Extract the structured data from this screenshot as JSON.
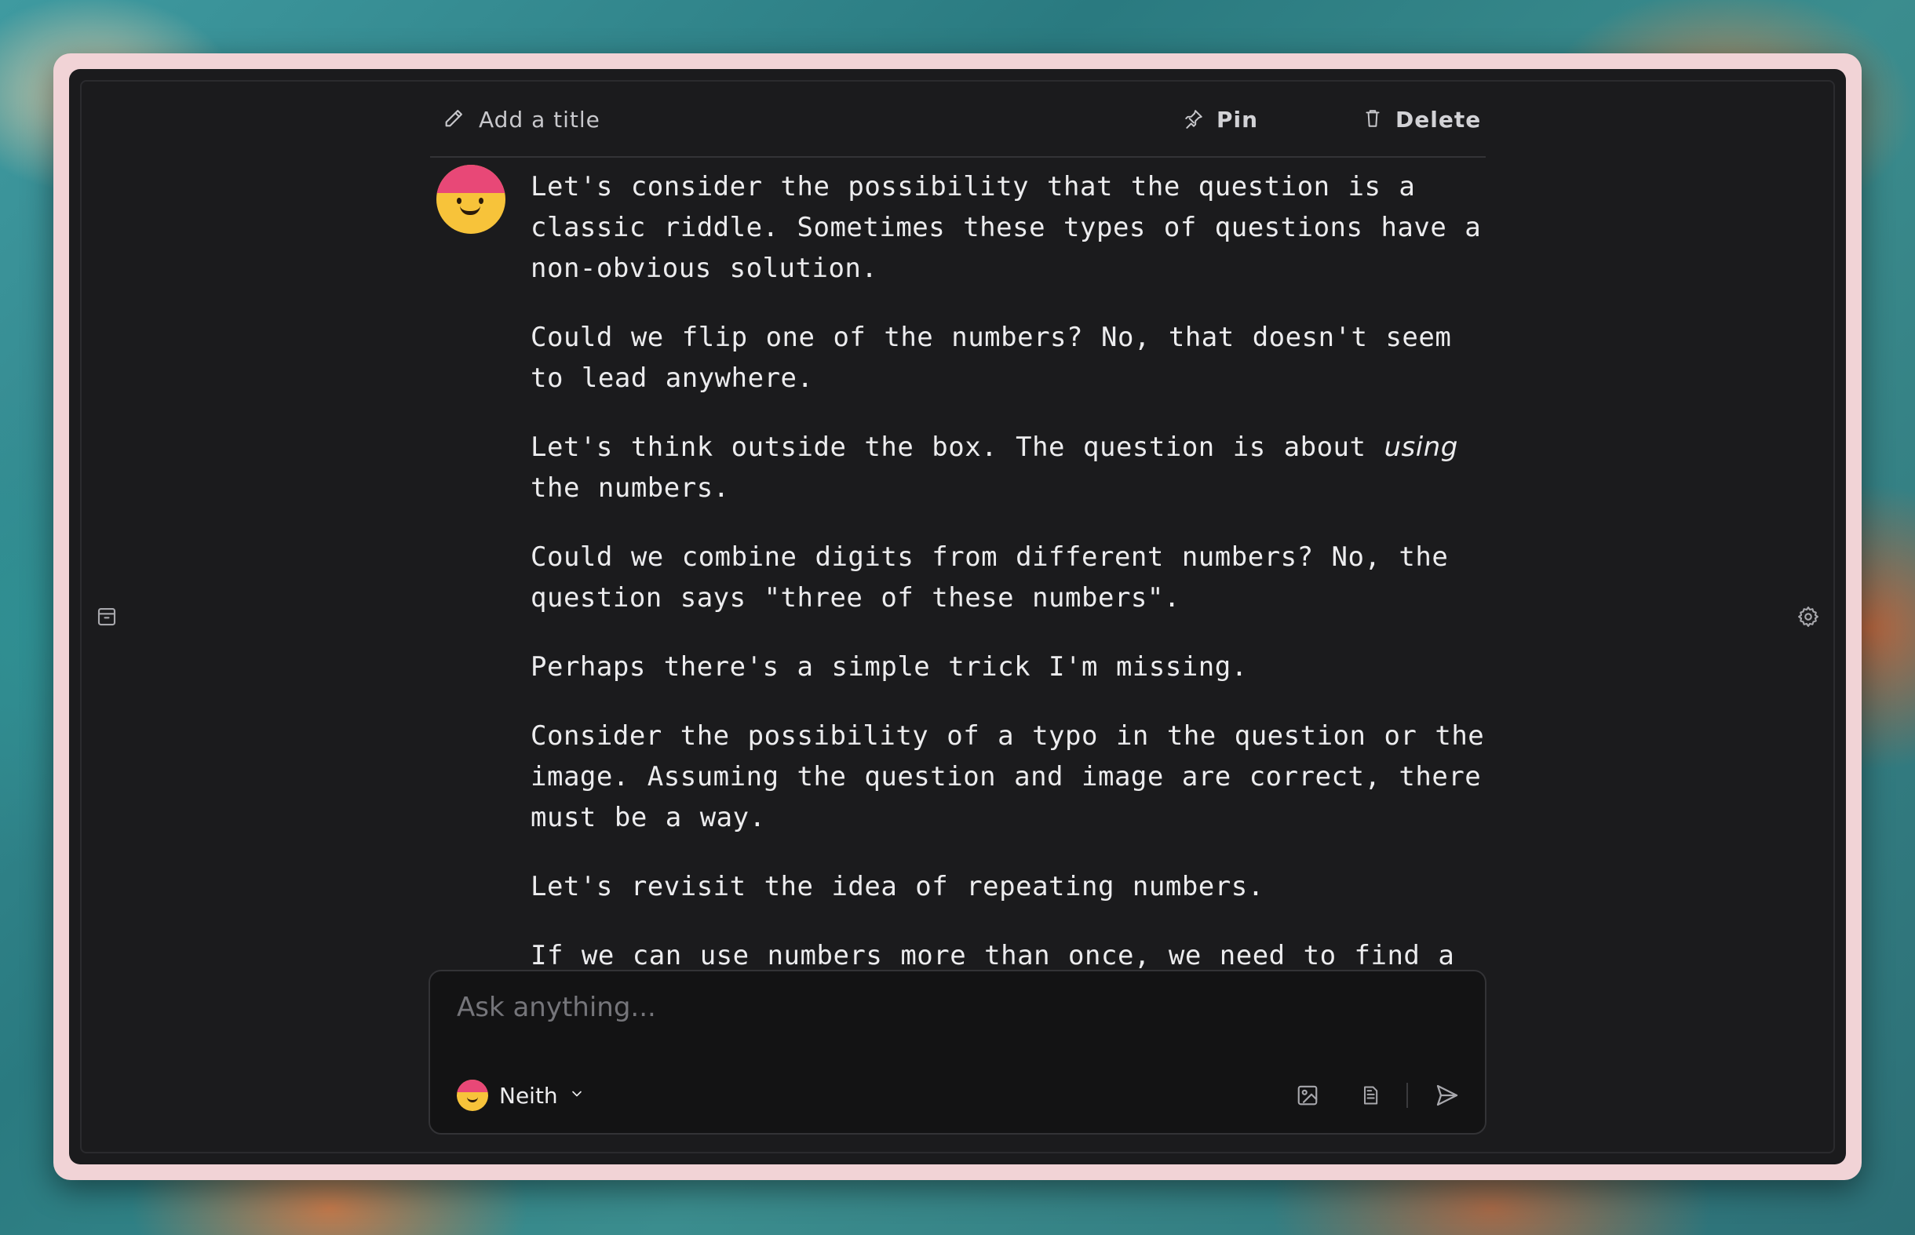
{
  "header": {
    "add_title": "Add a title",
    "pin": "Pin",
    "delete": "Delete"
  },
  "messages": [
    "Let's consider the possibility that the question is a classic riddle. Sometimes these types of questions have a non-obvious solution.",
    "Could we flip one of the numbers?  No, that doesn't seem to lead anywhere.",
    {
      "before": "Let's think outside the box. The question is about ",
      "em": "using",
      "after": " the numbers."
    },
    "Could we combine digits from different numbers?  No, the question says \"three of these numbers\".",
    "Perhaps there's a simple trick I'm missing.",
    "Consider the possibility of a typo in the question or the image. Assuming the question and image are correct, there must be a way.",
    "Let's revisit the idea of repeating numbers.",
    "If we can use numbers more than once, we need to find a"
  ],
  "composer": {
    "placeholder": "Ask anything...",
    "model_name": "Neith"
  },
  "icons": {
    "add_title": "pencil-icon",
    "pin": "pin-icon",
    "delete": "trash-icon",
    "left_sidebar": "archive-icon",
    "right_sidebar": "gear-icon",
    "image": "image-icon",
    "document": "document-icon",
    "send": "send-icon",
    "model_dropdown": "chevron-down-icon"
  }
}
